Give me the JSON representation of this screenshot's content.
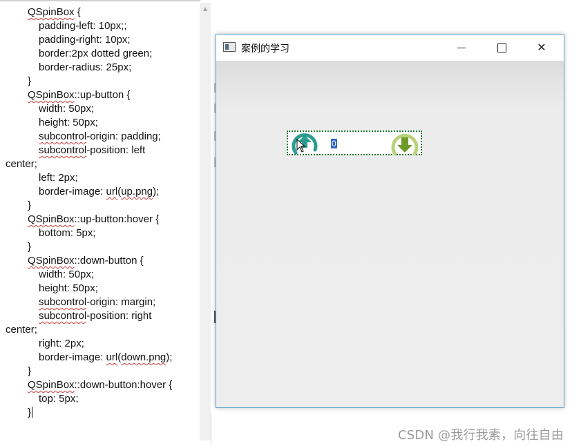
{
  "editor": {
    "lines": [
      {
        "indent": "ind1",
        "parts": [
          {
            "t": "QSpinBox",
            "sq": true
          },
          {
            "t": " {"
          }
        ]
      },
      {
        "indent": "ind2",
        "parts": [
          {
            "t": "padding-left: 10px;;"
          }
        ]
      },
      {
        "indent": "ind2",
        "parts": [
          {
            "t": "padding-right: 10px;"
          }
        ]
      },
      {
        "indent": "ind2",
        "parts": [
          {
            "t": "border:2px dotted green;"
          }
        ]
      },
      {
        "indent": "ind2",
        "parts": [
          {
            "t": "border-radius: 25px;"
          }
        ]
      },
      {
        "indent": "ind1",
        "parts": [
          {
            "t": "}"
          }
        ]
      },
      {
        "indent": "ind1",
        "parts": [
          {
            "t": "QSpinBox",
            "sq": true
          },
          {
            "t": "::up-button {"
          }
        ]
      },
      {
        "indent": "ind2",
        "parts": [
          {
            "t": "width: 50px;"
          }
        ]
      },
      {
        "indent": "ind2",
        "parts": [
          {
            "t": "height: 50px;"
          }
        ]
      },
      {
        "indent": "ind2",
        "parts": [
          {
            "t": "subcontrol",
            "sq": true
          },
          {
            "t": "-origin: padding;"
          }
        ]
      },
      {
        "indent": "ind2",
        "parts": [
          {
            "t": "subcontrol",
            "sq": true
          },
          {
            "t": "-position: left"
          }
        ]
      },
      {
        "indent": "ind0",
        "parts": [
          {
            "t": "center;"
          }
        ]
      },
      {
        "indent": "ind2",
        "parts": [
          {
            "t": "left: 2px;"
          }
        ]
      },
      {
        "indent": "ind2",
        "parts": [
          {
            "t": "border-image: "
          },
          {
            "t": "url",
            "sq": true
          },
          {
            "t": "("
          },
          {
            "t": "up.png",
            "sq": true
          },
          {
            "t": ");"
          }
        ]
      },
      {
        "indent": "ind1",
        "parts": [
          {
            "t": "}"
          }
        ]
      },
      {
        "indent": "ind1",
        "parts": [
          {
            "t": "QSpinBox",
            "sq": true
          },
          {
            "t": "::up-button:hover {"
          }
        ]
      },
      {
        "indent": "ind2",
        "parts": [
          {
            "t": "bottom: 5px;"
          }
        ]
      },
      {
        "indent": "ind1",
        "parts": [
          {
            "t": "}"
          }
        ]
      },
      {
        "indent": "ind1",
        "parts": [
          {
            "t": "QSpinBox",
            "sq": true
          },
          {
            "t": "::down-button {"
          }
        ]
      },
      {
        "indent": "ind2",
        "parts": [
          {
            "t": "width: 50px;"
          }
        ]
      },
      {
        "indent": "ind2",
        "parts": [
          {
            "t": "height: 50px;"
          }
        ]
      },
      {
        "indent": "ind2",
        "parts": [
          {
            "t": "subcontrol",
            "sq": true
          },
          {
            "t": "-origin: margin;"
          }
        ]
      },
      {
        "indent": "ind2",
        "parts": [
          {
            "t": "subcontrol",
            "sq": true
          },
          {
            "t": "-position: right"
          }
        ]
      },
      {
        "indent": "ind0",
        "parts": [
          {
            "t": "center;"
          }
        ]
      },
      {
        "indent": "ind2",
        "parts": [
          {
            "t": "right: 2px;"
          }
        ]
      },
      {
        "indent": "ind2",
        "parts": [
          {
            "t": "border-image: "
          },
          {
            "t": "url",
            "sq": true
          },
          {
            "t": "("
          },
          {
            "t": "down.png",
            "sq": true
          },
          {
            "t": ");"
          }
        ]
      },
      {
        "indent": "ind1",
        "parts": [
          {
            "t": "}"
          }
        ]
      },
      {
        "indent": "ind1",
        "parts": [
          {
            "t": "QSpinBox",
            "sq": true
          },
          {
            "t": "::down-button:hover {"
          }
        ]
      },
      {
        "indent": "ind2",
        "parts": [
          {
            "t": "top: 5px;"
          }
        ]
      },
      {
        "indent": "ind1",
        "parts": [
          {
            "t": "}"
          }
        ],
        "caret": true
      }
    ]
  },
  "window": {
    "title": "案例的学习",
    "minimize_icon": "minimize-icon",
    "maximize_icon": "maximize-icon",
    "close_icon": "close-icon",
    "close_glyph": "✕",
    "border_color": "#5aa4c9"
  },
  "spinbox": {
    "value": "0",
    "border_color": "#1d7a2f",
    "up_button_color": "#2a9d8f",
    "down_button_color": "#6e9a2a",
    "up_icon": "arrow-up-circle-icon",
    "down_icon": "arrow-down-circle-icon"
  },
  "watermark": "CSDN @我行我素，向往自由"
}
